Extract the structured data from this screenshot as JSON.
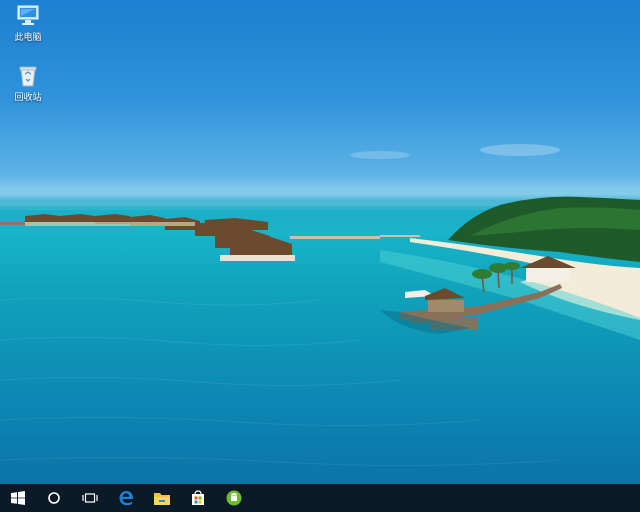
{
  "desktop": {
    "icons": [
      {
        "label": "此电脑",
        "icon": "this-pc-icon"
      },
      {
        "label": "回收站",
        "icon": "recycle-bin-icon"
      }
    ],
    "wallpaper": "tropical-resort-lagoon"
  },
  "taskbar": {
    "items": [
      {
        "name": "start",
        "icon": "windows-logo-icon"
      },
      {
        "name": "cortana-search",
        "icon": "circle-icon"
      },
      {
        "name": "task-view",
        "icon": "task-view-icon"
      },
      {
        "name": "edge",
        "icon": "edge-browser-icon"
      },
      {
        "name": "file-explorer",
        "icon": "folder-icon"
      },
      {
        "name": "store",
        "icon": "store-bag-icon"
      },
      {
        "name": "android-app",
        "icon": "android-icon"
      }
    ]
  },
  "colors": {
    "taskbar_bg": "#0b1a26",
    "sky_top": "#1d7fcf",
    "lagoon": "#18b4c9",
    "edge_blue": "#1e7fd6",
    "folder_yellow": "#f3c443",
    "android_green": "#6cbf2c"
  }
}
